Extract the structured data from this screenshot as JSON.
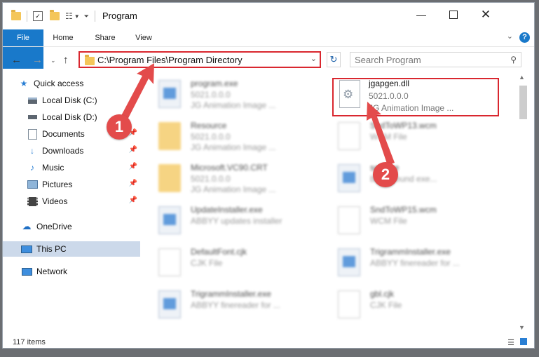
{
  "window": {
    "title": "Program"
  },
  "ribbon": {
    "tabs": [
      "File",
      "Home",
      "Share",
      "View"
    ],
    "help": "?"
  },
  "nav": {
    "address": "C:\\Program Files\\Program Directory",
    "search_placeholder": "Search Program"
  },
  "sidebar": {
    "items": [
      {
        "label": "Quick access",
        "icon": "star-icon"
      },
      {
        "label": "Local Disk (C:)",
        "icon": "drive-icon"
      },
      {
        "label": "Local Disk (D:)",
        "icon": "drive-icon"
      },
      {
        "label": "Documents",
        "icon": "documents-icon"
      },
      {
        "label": "Downloads",
        "icon": "download-icon"
      },
      {
        "label": "Music",
        "icon": "music-icon"
      },
      {
        "label": "Pictures",
        "icon": "pictures-icon"
      },
      {
        "label": "Videos",
        "icon": "videos-icon"
      },
      {
        "label": "OneDrive",
        "icon": "cloud-icon"
      },
      {
        "label": "This PC",
        "icon": "computer-icon"
      },
      {
        "label": "Network",
        "icon": "network-icon"
      }
    ]
  },
  "files": [
    {
      "name": "program.exe",
      "line1": "5021.0.0.0",
      "line2": "JG Animation Image ...",
      "icon": "app"
    },
    {
      "name": "Resource",
      "line1": "5021.0.0.0",
      "line2": "JG Animation Image ...",
      "icon": "folder"
    },
    {
      "name": "Microsoft.VC90.CRT",
      "line1": "5021.0.0.0",
      "line2": "JG Animation Image ...",
      "icon": "folder"
    },
    {
      "name": "UpdateInstaller.exe",
      "line1": "ABBYY updates installer",
      "line2": "",
      "icon": "app"
    },
    {
      "name": "DefaultFont.cjk",
      "line1": "CJK File",
      "line2": "",
      "icon": "doc"
    },
    {
      "name": "TrigrammInstaller.exe",
      "line1": "ABBYY finereader for ...",
      "line2": "",
      "icon": "app"
    },
    {
      "name": "jgapgen.dll",
      "line1": "5021.0.0.0",
      "line2": "JG Animation Image ...",
      "icon": "dll"
    },
    {
      "name": "SndToWP13.wcm",
      "line1": "WCM File",
      "line2": "",
      "icon": "doc"
    },
    {
      "name": "sec.exe",
      "line1": "background exe...",
      "line2": "",
      "icon": "app"
    },
    {
      "name": "SndToWP15.wcm",
      "line1": "WCM File",
      "line2": "",
      "icon": "doc"
    },
    {
      "name": "TrigrammInstaller.exe",
      "line1": "ABBYY finereader for ...",
      "line2": "",
      "icon": "app"
    },
    {
      "name": "gbl.cjk",
      "line1": "CJK File",
      "line2": "",
      "icon": "doc"
    }
  ],
  "status": {
    "count": "117 items"
  },
  "annotations": {
    "step1": "1",
    "step2": "2",
    "color": "#e34b4b"
  }
}
